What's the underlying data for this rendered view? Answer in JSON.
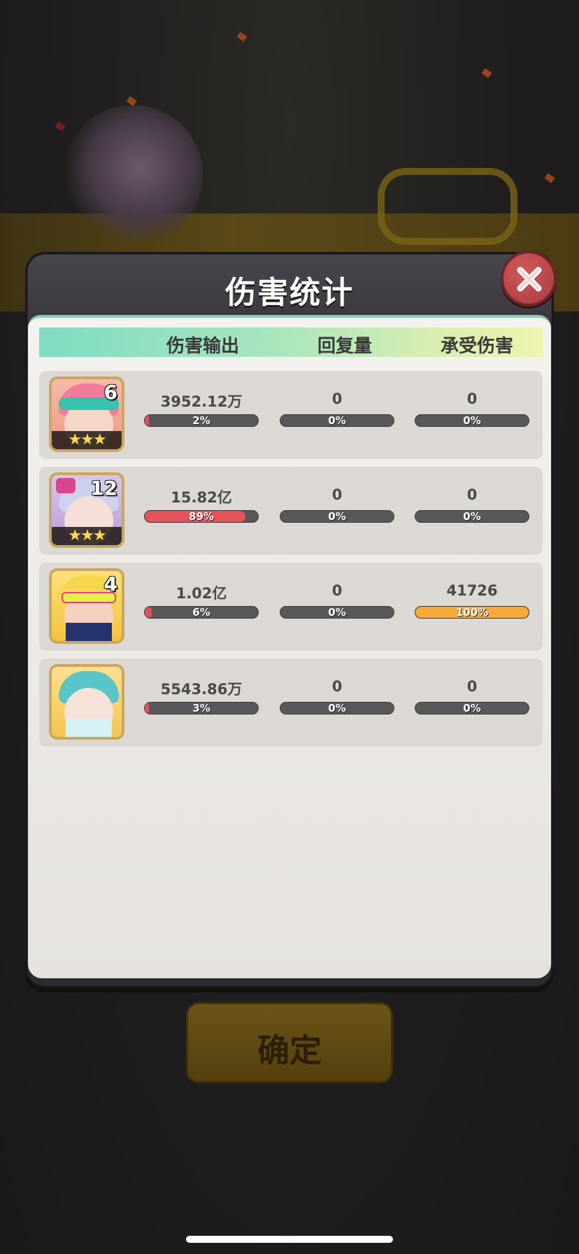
{
  "dialog": {
    "title": "伤害统计",
    "columns": [
      "伤害输出",
      "回复量",
      "承受伤害"
    ]
  },
  "confirm_button": {
    "label": "确定"
  },
  "colors": {
    "damage_bar": "#e5525a",
    "taken_bar": "#f5a93a",
    "empty_bar": "#585858",
    "header_gradient_start": "#7fdcc3",
    "header_gradient_end": "#eef4ae"
  },
  "heroes": [
    {
      "level": "6",
      "stars": "★★★",
      "damage": "3952.12万",
      "damage_pct": "2%",
      "damage_fraction": 0.02,
      "heal": "0",
      "heal_pct": "0%",
      "heal_fraction": 0,
      "taken": "0",
      "taken_pct": "0%",
      "taken_fraction": 0,
      "icon": "pink-hair-goggles-hero-icon"
    },
    {
      "level": "12",
      "stars": "★★★",
      "damage": "15.82亿",
      "damage_pct": "89%",
      "damage_fraction": 0.89,
      "heal": "0",
      "heal_pct": "0%",
      "heal_fraction": 0,
      "taken": "0",
      "taken_pct": "0%",
      "taken_fraction": 0,
      "icon": "silver-hair-bow-hero-icon"
    },
    {
      "level": "4",
      "stars": "",
      "damage": "1.02亿",
      "damage_pct": "6%",
      "damage_fraction": 0.06,
      "heal": "0",
      "heal_pct": "0%",
      "heal_fraction": 0,
      "taken": "41726",
      "taken_pct": "100%",
      "taken_fraction": 1.0,
      "icon": "blonde-visor-hero-icon"
    },
    {
      "level": "",
      "stars": "",
      "damage": "5543.86万",
      "damage_pct": "3%",
      "damage_fraction": 0.03,
      "heal": "0",
      "heal_pct": "0%",
      "heal_fraction": 0,
      "taken": "0",
      "taken_pct": "0%",
      "taken_fraction": 0,
      "icon": "teal-hair-hero-icon"
    }
  ]
}
